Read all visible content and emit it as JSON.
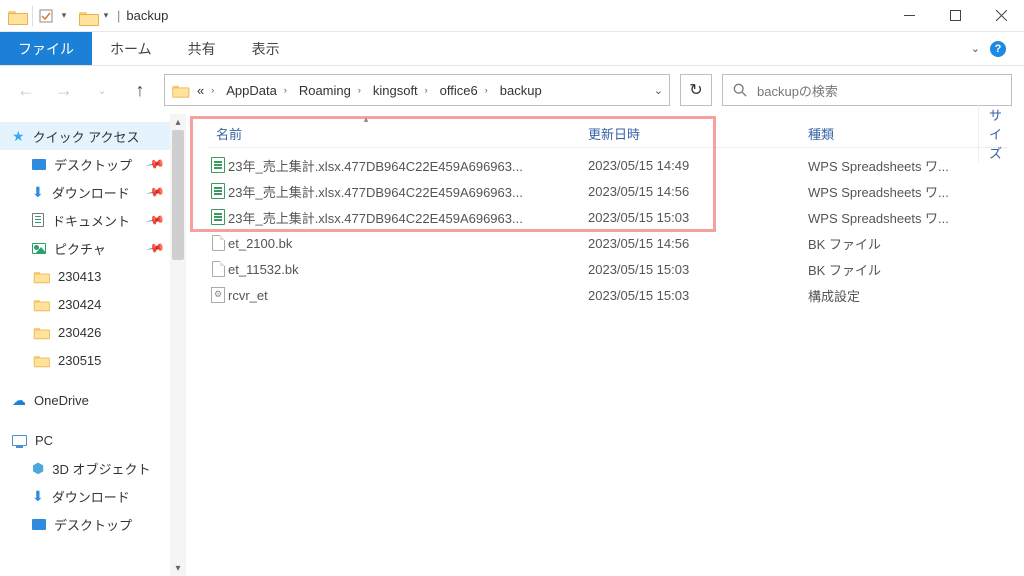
{
  "titlebar": {
    "title": "backup",
    "separator": "|"
  },
  "ribbon": {
    "file": "ファイル",
    "tabs": [
      "ホーム",
      "共有",
      "表示"
    ]
  },
  "breadcrumb": {
    "start": "«",
    "parts": [
      "AppData",
      "Roaming",
      "kingsoft",
      "office6",
      "backup"
    ]
  },
  "search": {
    "placeholder": "backupの検索"
  },
  "sidebar": {
    "quick_access": "クイック アクセス",
    "desktop": "デスクトップ",
    "downloads": "ダウンロード",
    "documents": "ドキュメント",
    "pictures": "ピクチャ",
    "folders": [
      "230413",
      "230424",
      "230426",
      "230515"
    ],
    "onedrive": "OneDrive",
    "pc": "PC",
    "objects3d": "3D オブジェクト",
    "downloads2": "ダウンロード",
    "desktop2": "デスクトップ"
  },
  "columns": {
    "name": "名前",
    "date": "更新日時",
    "type": "種類",
    "size": "サイズ"
  },
  "files": [
    {
      "name": "23年_売上集計.xlsx.477DB964C22E459A696963...",
      "date": "2023/05/15 14:49",
      "type": "WPS Spreadsheets ワ...",
      "icon": "xlsx"
    },
    {
      "name": "23年_売上集計.xlsx.477DB964C22E459A696963...",
      "date": "2023/05/15 14:56",
      "type": "WPS Spreadsheets ワ...",
      "icon": "xlsx"
    },
    {
      "name": "23年_売上集計.xlsx.477DB964C22E459A696963...",
      "date": "2023/05/15 15:03",
      "type": "WPS Spreadsheets ワ...",
      "icon": "xlsx"
    },
    {
      "name": "et_2100.bk",
      "date": "2023/05/15 14:56",
      "type": "BK ファイル",
      "icon": "file"
    },
    {
      "name": "et_11532.bk",
      "date": "2023/05/15 15:03",
      "type": "BK ファイル",
      "icon": "file"
    },
    {
      "name": "rcvr_et",
      "date": "2023/05/15 15:03",
      "type": "構成設定",
      "icon": "cfg"
    }
  ]
}
